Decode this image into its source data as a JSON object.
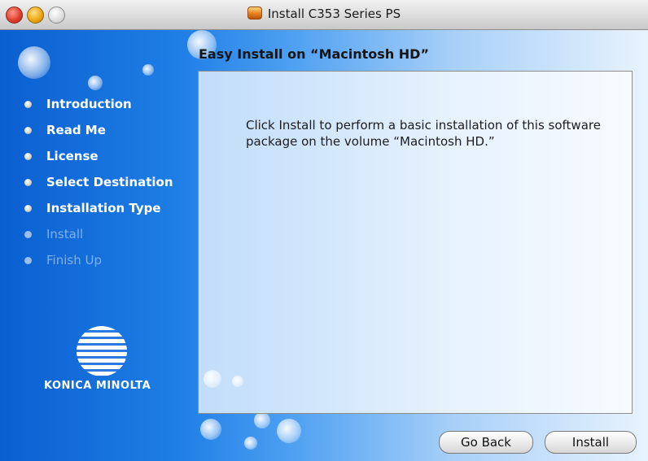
{
  "window": {
    "title": "Install C353 Series PS"
  },
  "heading": "Easy Install on “Macintosh HD”",
  "panel": {
    "text": "Click Install to perform a basic installation of this software package on the volume “Macintosh HD.”"
  },
  "steps": [
    {
      "label": "Introduction",
      "state": "done"
    },
    {
      "label": "Read Me",
      "state": "done"
    },
    {
      "label": "License",
      "state": "done"
    },
    {
      "label": "Select Destination",
      "state": "done"
    },
    {
      "label": "Installation Type",
      "state": "current"
    },
    {
      "label": "Install",
      "state": "pending"
    },
    {
      "label": "Finish Up",
      "state": "pending"
    }
  ],
  "logo": {
    "text": "KONICA MINOLTA"
  },
  "buttons": {
    "back": "Go Back",
    "install": "Install"
  },
  "colors": {
    "sidebar_blue": "#0a5fd0",
    "accent": "#1f7fe6"
  }
}
